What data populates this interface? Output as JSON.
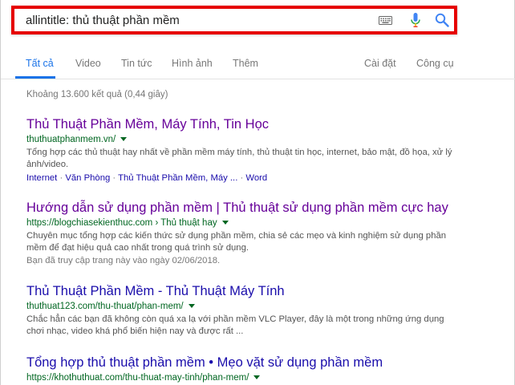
{
  "search": {
    "query": "allintitle: thủ thuật phần mềm"
  },
  "tabs": [
    {
      "label": "Tất cả",
      "active": true
    },
    {
      "label": "Video"
    },
    {
      "label": "Tin tức"
    },
    {
      "label": "Hình ảnh"
    },
    {
      "label": "Thêm"
    }
  ],
  "tools": {
    "settings": "Cài đặt",
    "tools": "Công cụ"
  },
  "stats": "Khoảng 13.600 kết quả (0,44 giây)",
  "results": [
    {
      "title": "Thủ Thuật Phần Mềm, Máy Tính, Tin Học",
      "url": "thuthuatphanmem.vn/",
      "snippet": "Tổng hợp các thủ thuật hay nhất về phần mềm máy tính, thủ thuật tin học, internet, bảo mật, đồ họa, xử lý ảnh/video.",
      "sitelinks": [
        "Internet",
        "Văn Phòng",
        "Thủ Thuật Phần Mềm, Máy ...",
        "Word"
      ]
    },
    {
      "title": "Hướng dẫn sử dụng phần mềm | Thủ thuật sử dụng phần mềm cực hay",
      "url": "https://blogchiasekienthuc.com › Thủ thuật hay",
      "snippet": "Chuyên mục tổng hợp các kiến thức sử dụng phần mềm, chia sẻ các mẹo và kinh nghiệm sử dụng phần mềm để đạt hiệu quả cao nhất trong quá trình sử dụng.",
      "visited": "Bạn đã truy cập trang này vào ngày 02/06/2018."
    },
    {
      "title": "Thủ Thuật Phần Mềm - Thủ Thuật Máy Tính",
      "url": "thuthuat123.com/thu-thuat/phan-mem/",
      "snippet": "Chắc hẳn các bạn đã không còn quá xa lạ với phần mềm VLC Player, đây là một trong những ứng dụng chơi nhạc, video khá phổ biến hiện nay và được rất ..."
    },
    {
      "title": "Tổng hợp thủ thuật phần mềm • Mẹo vặt sử dụng phần mềm",
      "url": "https://khothuthuat.com/thu-thuat-may-tinh/phan-mem/"
    }
  ],
  "colors": {
    "highlight_border": "#e60000",
    "visited_link": "#660099",
    "link": "#1a0dab",
    "url": "#006621",
    "active_tab": "#1a73e8"
  },
  "icons": [
    "keyboard-icon",
    "microphone-icon",
    "search-icon"
  ]
}
